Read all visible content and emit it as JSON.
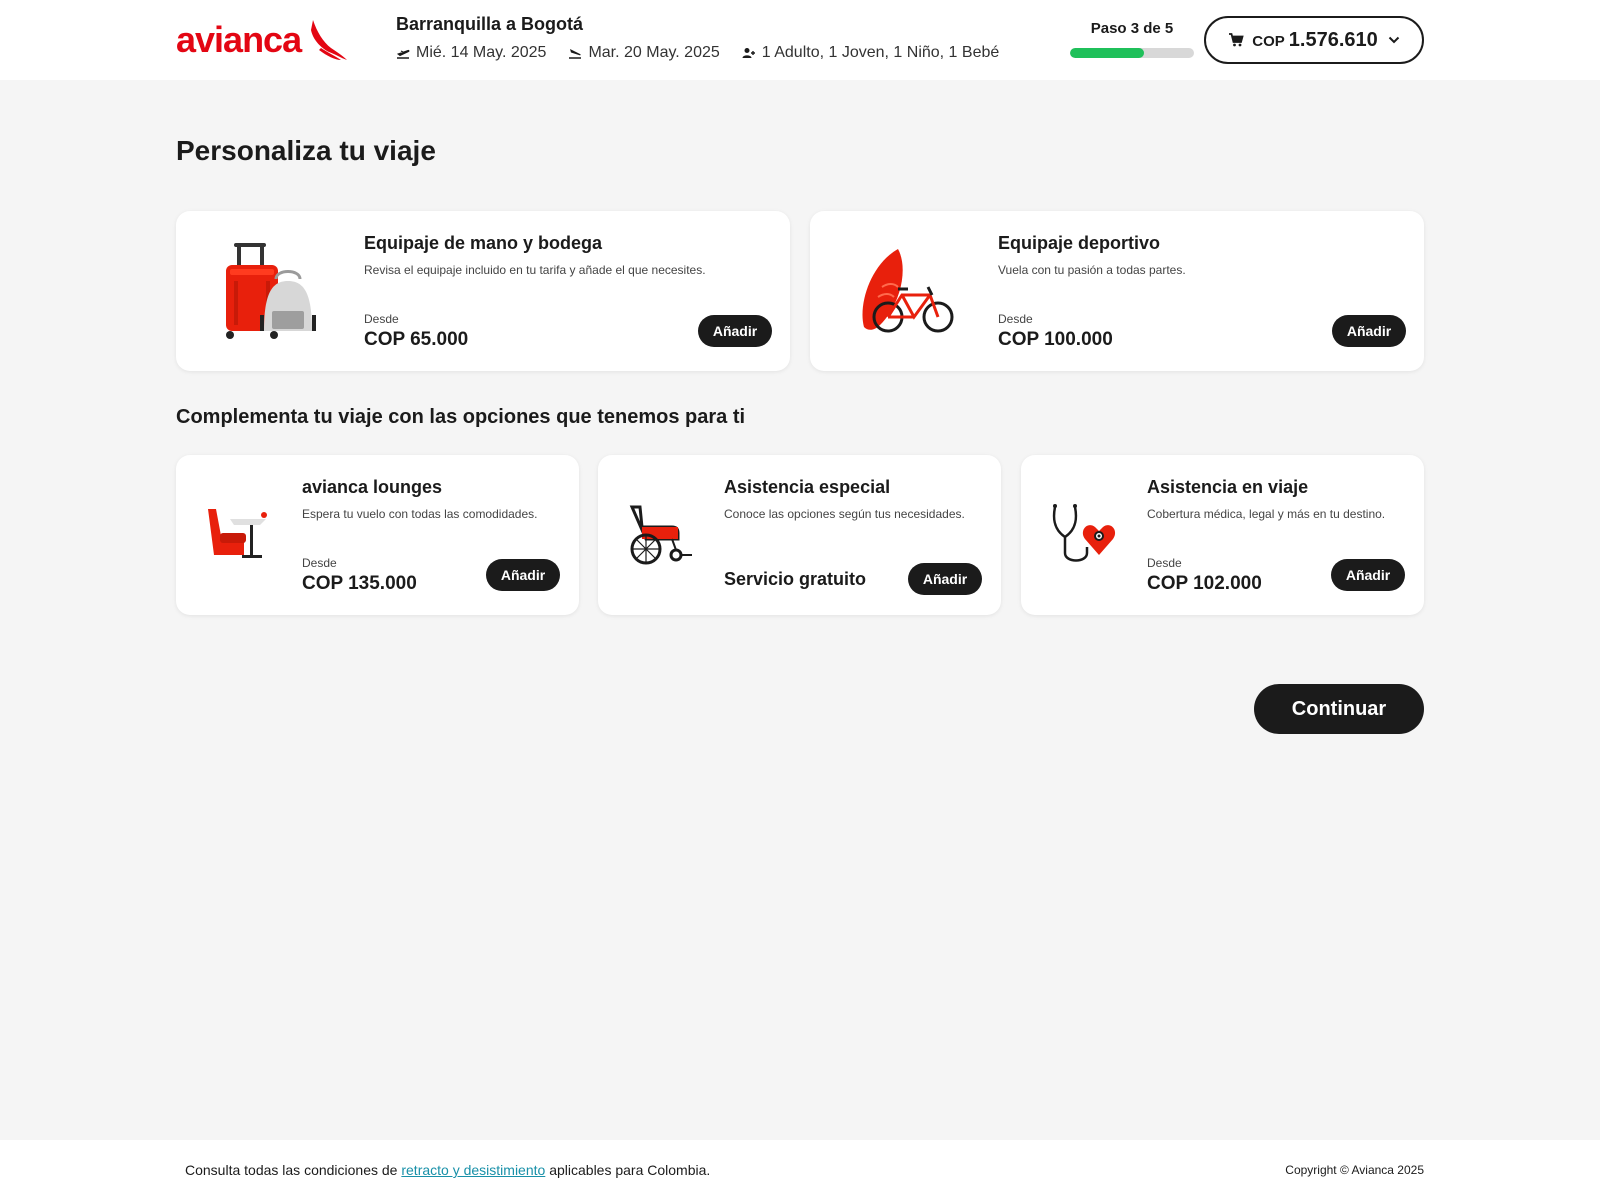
{
  "header": {
    "logo_text": "avianca",
    "route": "Barranquilla a Bogotá",
    "departure_date": "Mié. 14 May. 2025",
    "return_date": "Mar. 20 May. 2025",
    "passengers": "1 Adulto, 1 Joven, 1 Niño, 1 Bebé",
    "step_label": "Paso 3 de 5",
    "step_progress_fraction": 0.6,
    "progress_color": "#1fc05a",
    "cart_currency": "COP",
    "cart_total": "1.576.610"
  },
  "main": {
    "title": "Personaliza tu viaje",
    "primary_cards": [
      {
        "icon": "luggage-icon",
        "title": "Equipaje de mano y bodega",
        "description": "Revisa el equipaje incluido en tu tarifa y añade el que necesites.",
        "from_label": "Desde",
        "price": "COP 65.000",
        "button_label": "Añadir"
      },
      {
        "icon": "sports-equipment-icon",
        "title": "Equipaje deportivo",
        "description": "Vuela con tu pasión a todas partes.",
        "from_label": "Desde",
        "price": "COP 100.000",
        "button_label": "Añadir"
      }
    ],
    "section_title": "Complementa tu viaje con las opciones que tenemos para ti",
    "secondary_cards": [
      {
        "icon": "lounge-chair-icon",
        "title": "avianca lounges",
        "description": "Espera tu vuelo con todas las comodidades.",
        "from_label": "Desde",
        "price": "COP 135.000",
        "button_label": "Añadir"
      },
      {
        "icon": "wheelchair-icon",
        "title": "Asistencia especial",
        "description": "Conoce las opciones según tus necesidades.",
        "price_text": "Servicio gratuito",
        "button_label": "Añadir"
      },
      {
        "icon": "stethoscope-heart-icon",
        "title": "Asistencia en viaje",
        "description": "Cobertura médica, legal y más en tu destino.",
        "from_label": "Desde",
        "price": "COP 102.000",
        "button_label": "Añadir"
      }
    ],
    "continue_label": "Continuar"
  },
  "footer": {
    "text_before": "Consulta todas las condiciones de ",
    "link_text": "retracto y desistimiento",
    "text_after": " aplicables para Colombia.",
    "copyright": "Copyright © Avianca 2025"
  },
  "colors": {
    "brand_red": "#e30613",
    "dark": "#1b1b1b",
    "link": "#1890a8",
    "background": "#f5f5f5"
  }
}
